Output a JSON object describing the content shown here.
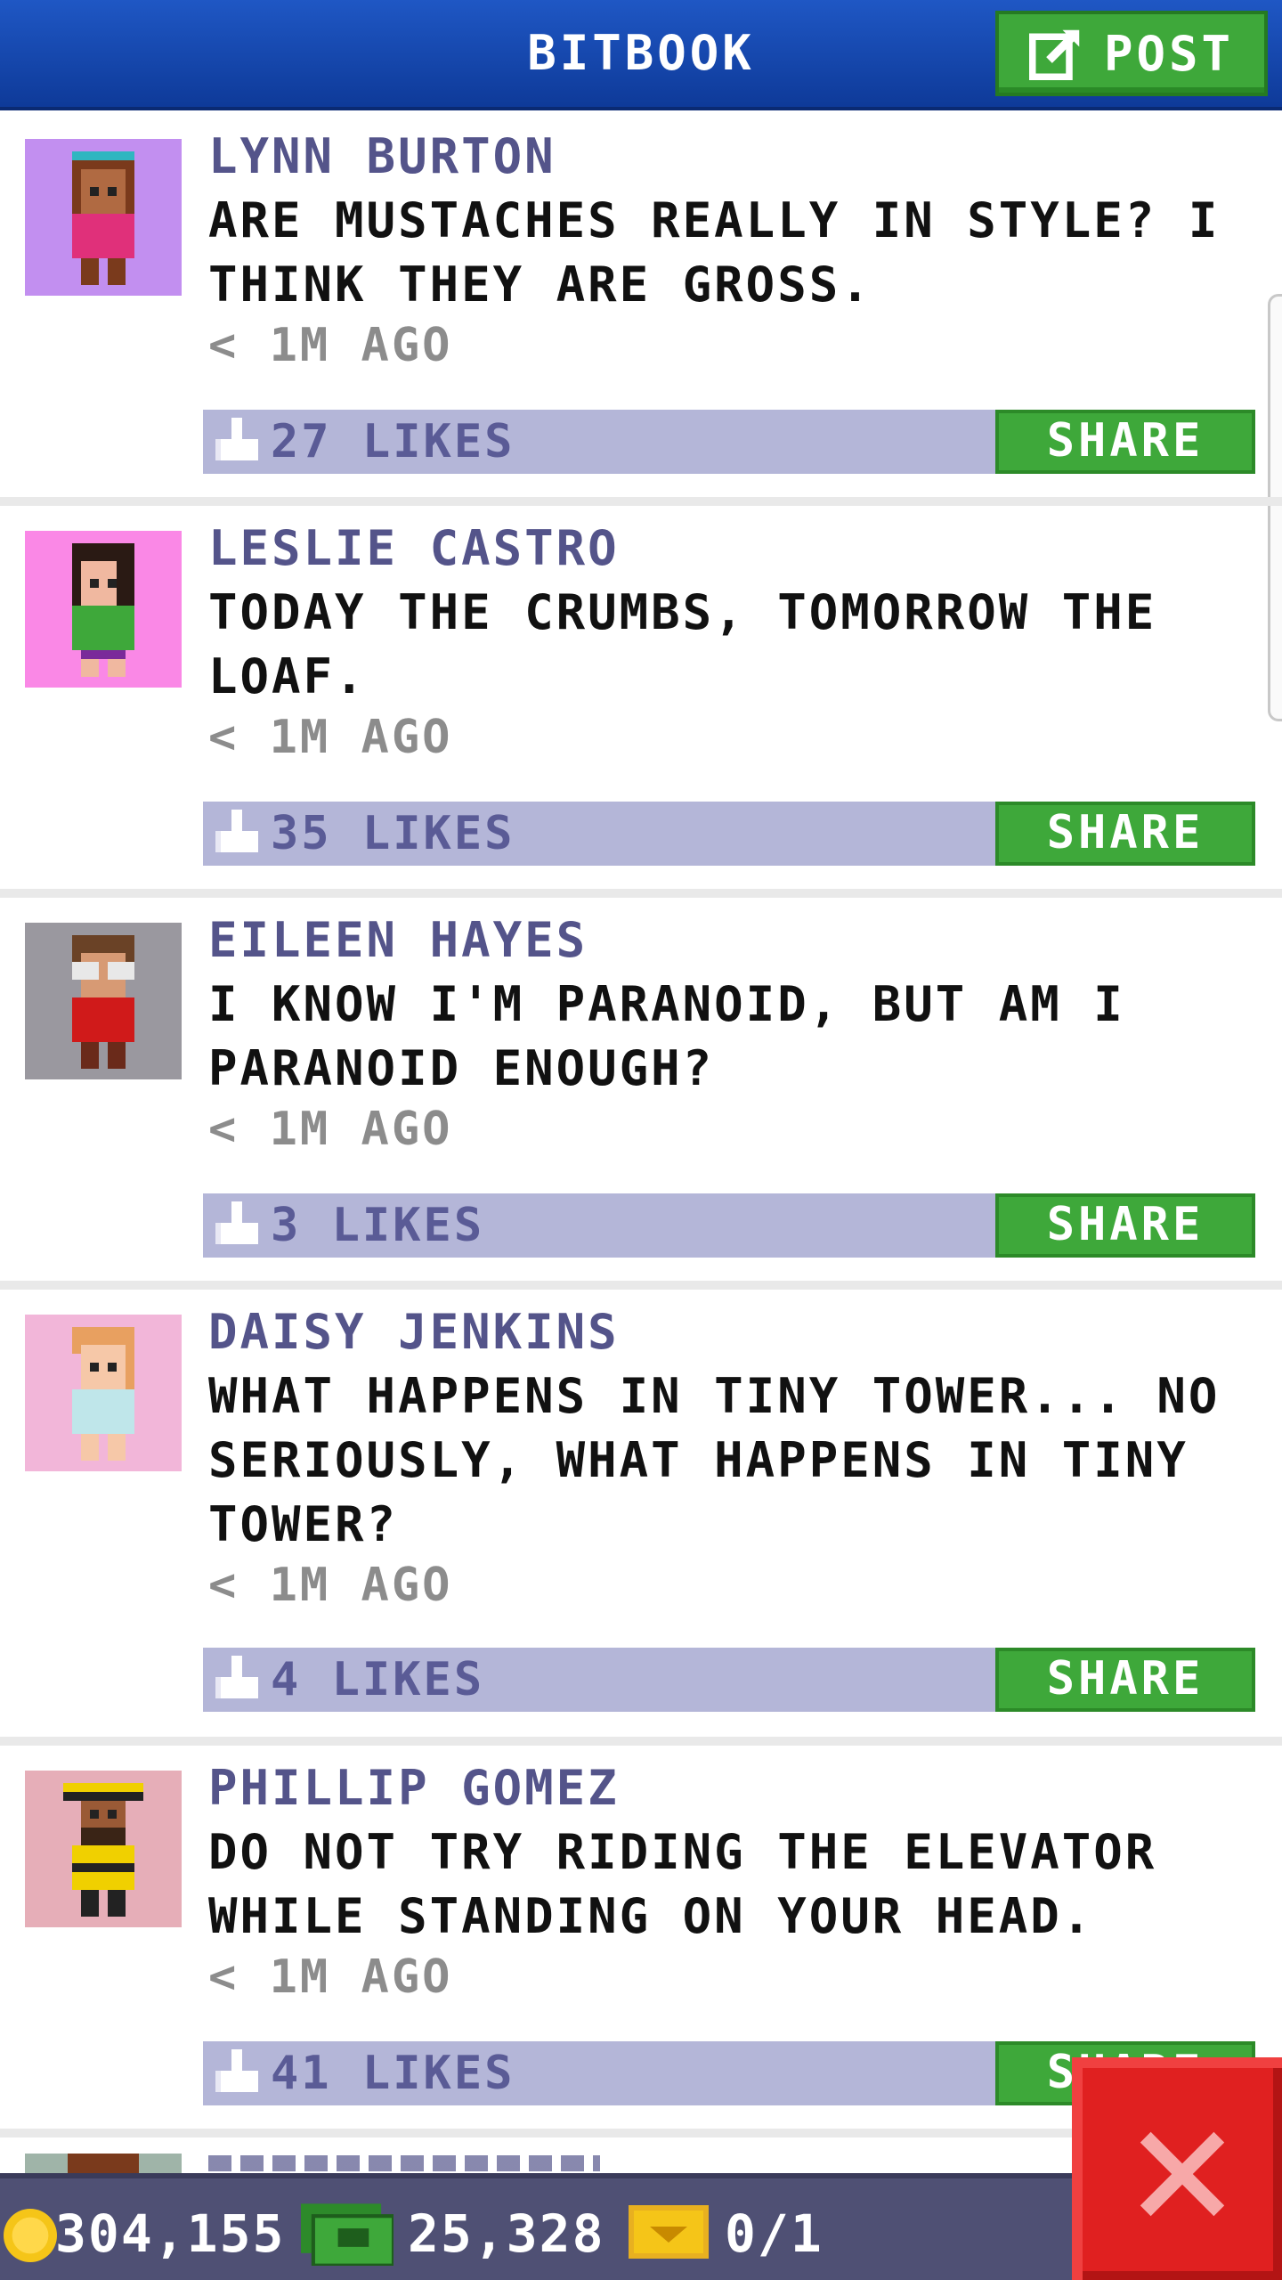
{
  "header": {
    "title": "BITBOOK",
    "post_label": "POST"
  },
  "posts": [
    {
      "author": "LYNN BURTON",
      "message": "ARE MUSTACHES REALLY IN STYLE? I THINK THEY ARE GROSS.",
      "time": "< 1M AGO",
      "likes": "27 LIKES",
      "share_label": "SHARE",
      "avatar_bg": "#c28ff0"
    },
    {
      "author": "LESLIE CASTRO",
      "message": "TODAY THE CRUMBS, TOMORROW THE LOAF.",
      "time": "< 1M AGO",
      "likes": "35 LIKES",
      "share_label": "SHARE",
      "avatar_bg": "#fa88e6"
    },
    {
      "author": "EILEEN HAYES",
      "message": "I KNOW I'M PARANOID, BUT AM I PARANOID ENOUGH?",
      "time": "< 1M AGO",
      "likes": "3 LIKES",
      "share_label": "SHARE",
      "avatar_bg": "#9a989f"
    },
    {
      "author": "DAISY JENKINS",
      "message": "WHAT HAPPENS IN TINY TOWER... NO SERIOUSLY, WHAT HAPPENS IN TINY TOWER?",
      "time": "< 1M AGO",
      "likes": "4 LIKES",
      "share_label": "SHARE",
      "avatar_bg": "#f2b6d9"
    },
    {
      "author": "PHILLIP GOMEZ",
      "message": "DO NOT TRY RIDING THE ELEVATOR WHILE STANDING ON YOUR HEAD.",
      "time": "< 1M AGO",
      "likes": "41 LIKES",
      "share_label": "SHARE",
      "avatar_bg": "#e6aeb8"
    }
  ],
  "status": {
    "coins": "304,155",
    "bux": "25,328",
    "tickets": "0/1"
  },
  "colors": {
    "header_blue": "#1a4fb8",
    "button_green": "#3ea83a",
    "like_bar": "#b4b6d8",
    "close_red": "#e02020"
  }
}
